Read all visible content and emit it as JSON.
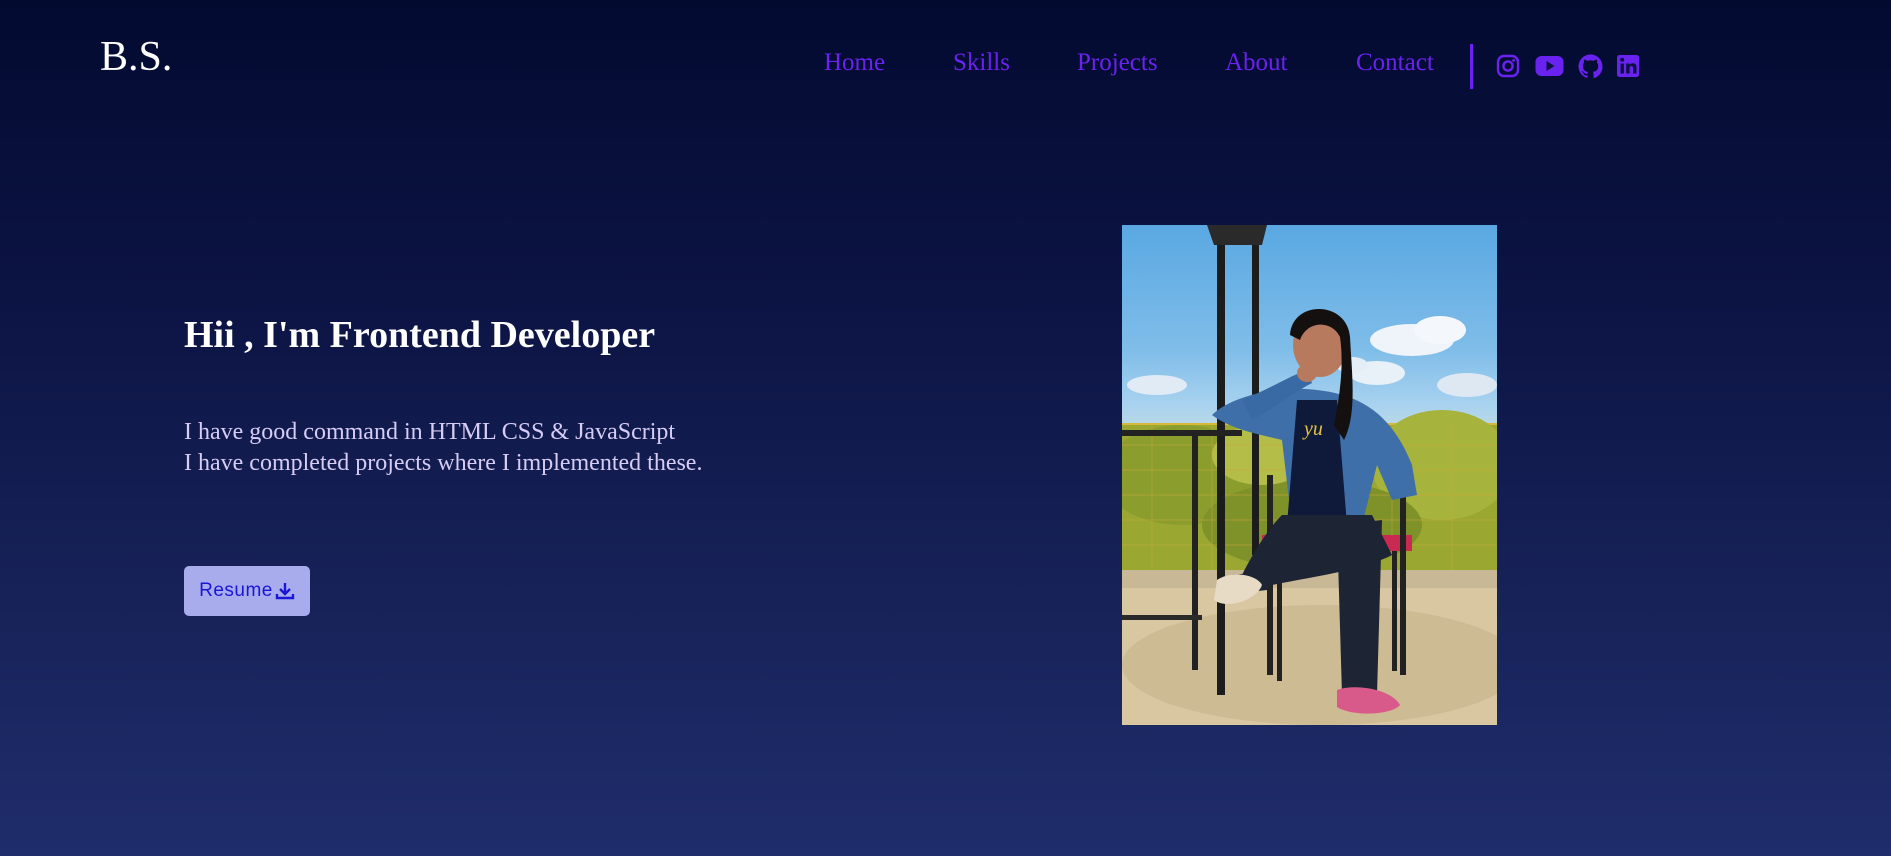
{
  "header": {
    "logo": "B.S.",
    "nav": [
      "Home",
      "Skills",
      "Projects",
      "About",
      "Contact"
    ],
    "social_icons": [
      "instagram-icon",
      "youtube-icon",
      "github-icon",
      "linkedin-icon"
    ]
  },
  "hero": {
    "title": "Hii , I'm Frontend Developer",
    "description_lines": [
      "I have good command in HTML CSS & JavaScript",
      "I have completed projects where I implemented these."
    ],
    "resume_button": "Resume",
    "resume_icon": "download-icon"
  },
  "colors": {
    "background_top": "#030a30",
    "background_bottom": "#1f2d6c",
    "accent": "#6a22f0",
    "button_bg": "#a9acec",
    "button_text": "#1a16d6"
  }
}
